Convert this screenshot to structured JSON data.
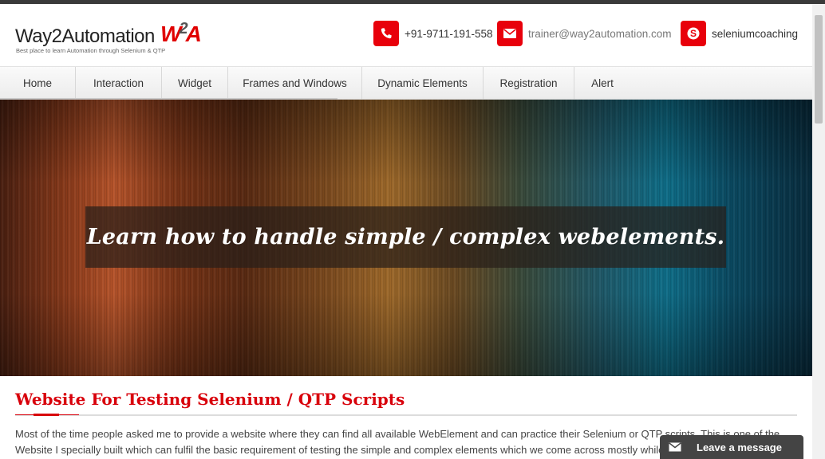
{
  "header": {
    "logo_text": "Way2Automation",
    "logo_mark_left": "W",
    "logo_mark_mid": "2",
    "logo_mark_right": "A",
    "logo_tagline": "Best place to learn Automation through Selenium & QTP",
    "phone": {
      "icon": "phone-icon",
      "text": "+91-9711-191-558"
    },
    "email": {
      "icon": "envelope-icon",
      "text": "trainer@way2automation.com"
    },
    "skype": {
      "icon": "skype-icon",
      "text": "seleniumcoaching"
    }
  },
  "nav": {
    "items": [
      {
        "label": "Home"
      },
      {
        "label": "Interaction"
      },
      {
        "label": "Widget"
      },
      {
        "label": "Frames and Windows"
      },
      {
        "label": "Dynamic Elements"
      },
      {
        "label": "Registration"
      },
      {
        "label": "Alert"
      }
    ]
  },
  "hero": {
    "caption": "Learn how to handle simple / complex webelements."
  },
  "main": {
    "heading": "Website For Testing Selenium / QTP Scripts",
    "paragraph": "Most of the time people asked me to provide a website where they can find all available WebElement and can practice their Selenium or QTP scripts. This is one of the Website I specially built which can fulfil the basic requirement of testing the simple and complex elements which we come across mostly while automating"
  },
  "chat_widget": {
    "icon": "envelope-icon",
    "label": "Leave a message"
  },
  "colors": {
    "accent": "#e8000b",
    "heading": "#d8000b",
    "chat_bg": "#444444"
  }
}
